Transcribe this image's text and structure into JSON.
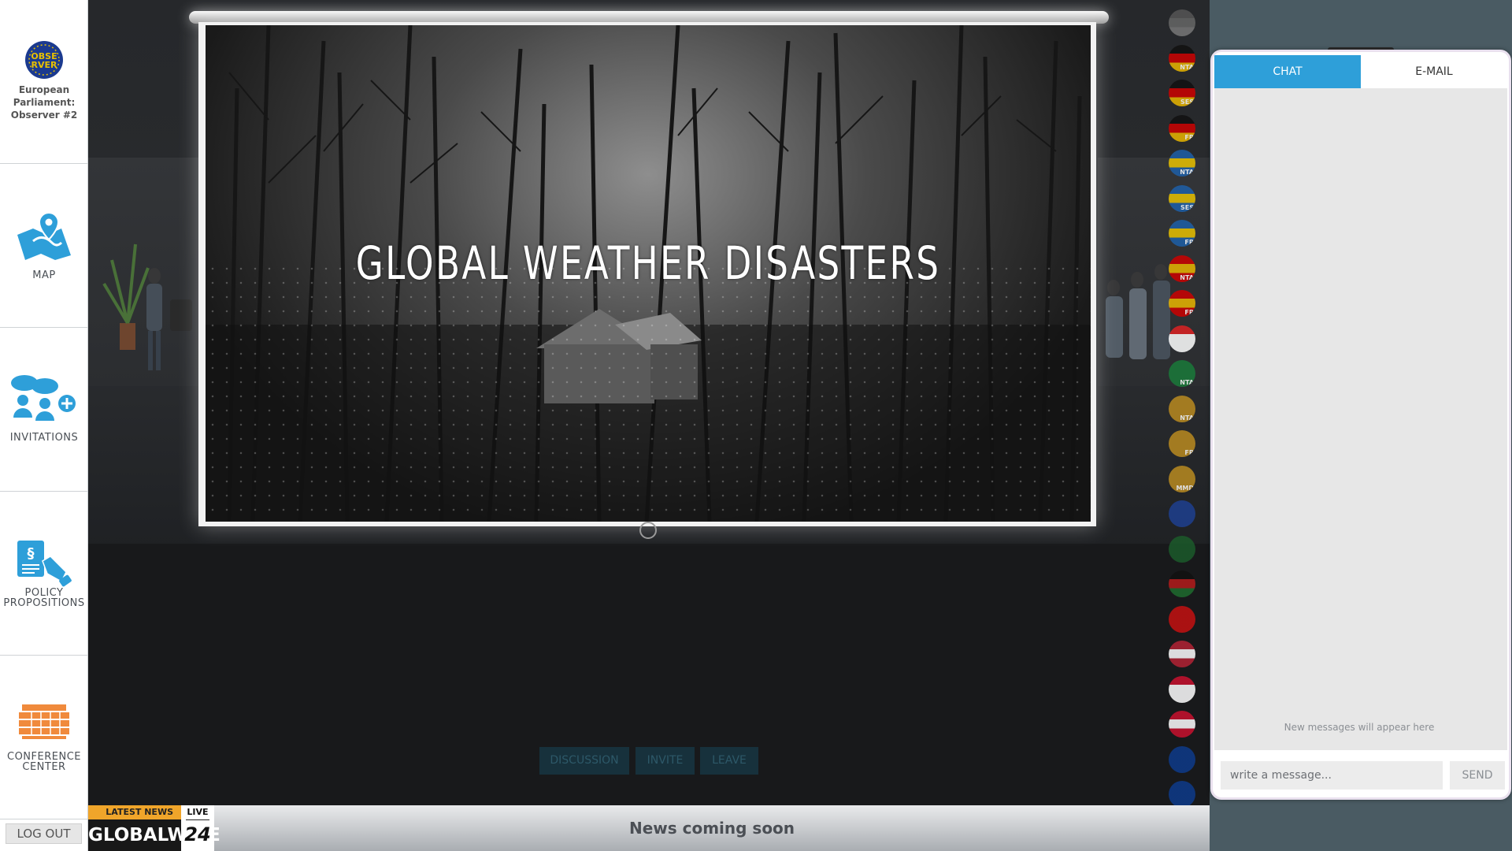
{
  "profile": {
    "badge_line1": "OBSE",
    "badge_line2": "RVER",
    "name_line1": "European",
    "name_line2": "Parliament:",
    "name_line3": "Observer #2"
  },
  "nav": {
    "map": "MAP",
    "invitations": "INVITATIONS",
    "policy_line1": "POLICY",
    "policy_line2": "PROPOSITIONS",
    "conference_line1": "CONFERENCE",
    "conference_line2": "CENTER",
    "logout": "LOG OUT"
  },
  "screen": {
    "title": "GLOBAL WEATHER DISASTERS"
  },
  "room_actions": {
    "discussion": "DISCUSSION",
    "invite": "INVITE",
    "leave": "LEAVE"
  },
  "participants": [
    {
      "tag": ""
    },
    {
      "tag": "NTA",
      "colors": [
        "#111",
        "#c00",
        "#e8b500"
      ]
    },
    {
      "tag": "SES",
      "colors": [
        "#111",
        "#c00",
        "#e8b500"
      ]
    },
    {
      "tag": "FR",
      "colors": [
        "#111",
        "#c00",
        "#e8b500"
      ]
    },
    {
      "tag": "NTA",
      "colors": [
        "#1d5fa8",
        "#e8c100",
        "#1d5fa8"
      ]
    },
    {
      "tag": "SES",
      "colors": [
        "#1d5fa8",
        "#e8c100",
        "#1d5fa8"
      ]
    },
    {
      "tag": "FR",
      "colors": [
        "#1d5fa8",
        "#e8c100",
        "#1d5fa8"
      ]
    },
    {
      "tag": "NTA",
      "colors": [
        "#c00",
        "#e8b500",
        "#c00"
      ]
    },
    {
      "tag": "FR",
      "colors": [
        "#c00",
        "#e8b500",
        "#c00"
      ]
    },
    {
      "tag": "MMD",
      "colors": [
        "#d22",
        "#fff",
        "#fff"
      ]
    },
    {
      "tag": "NTA",
      "colors": [
        "#1a7a3a",
        "#1a7a3a",
        "#1a7a3a"
      ]
    },
    {
      "tag": "NTA",
      "colors": [
        "#b98a20",
        "#b98a20",
        "#b98a20"
      ]
    },
    {
      "tag": "FR",
      "colors": [
        "#b98a20",
        "#b98a20",
        "#b98a20"
      ]
    },
    {
      "tag": "MMD",
      "colors": [
        "#b98a20",
        "#b98a20",
        "#b98a20"
      ]
    },
    {
      "tag": "",
      "colors": [
        "#1e3f8f",
        "#1e3f8f",
        "#1e3f8f"
      ]
    },
    {
      "tag": "",
      "colors": [
        "#1b5a2a",
        "#1b5a2a",
        "#1b5a2a"
      ]
    },
    {
      "tag": "",
      "colors": [
        "#111",
        "#b31b1b",
        "#1e6b2e"
      ]
    },
    {
      "tag": "",
      "colors": [
        "#c41010",
        "#c41010",
        "#c41010"
      ]
    },
    {
      "tag": "",
      "colors": [
        "#b22234",
        "#fff",
        "#b22234"
      ]
    },
    {
      "tag": "",
      "colors": [
        "#c8102e",
        "#fff",
        "#fff"
      ]
    },
    {
      "tag": "",
      "colors": [
        "#c8102e",
        "#fff",
        "#c8102e"
      ]
    },
    {
      "tag": "",
      "colors": [
        "#0d3a8a",
        "#0d3a8a",
        "#0d3a8a"
      ]
    },
    {
      "tag": "",
      "colors": [
        "#0d3a8a",
        "#0d3a8a",
        "#0d3a8a"
      ]
    }
  ],
  "ticker": {
    "latest_news": "LATEST NEWS",
    "brand": "GLOBALWIRE",
    "live": "LIVE",
    "live_num": "24",
    "headline": "News coming soon"
  },
  "chat": {
    "tab_chat": "CHAT",
    "tab_email": "E-MAIL",
    "empty_state": "New messages will appear here",
    "input_placeholder": "write a message...",
    "send": "SEND"
  },
  "colors": {
    "accent": "#2e9fd9",
    "nav_icon": "#2e9fd9",
    "conference_icon": "#f08a3c",
    "news_orange": "#f0a52a"
  }
}
